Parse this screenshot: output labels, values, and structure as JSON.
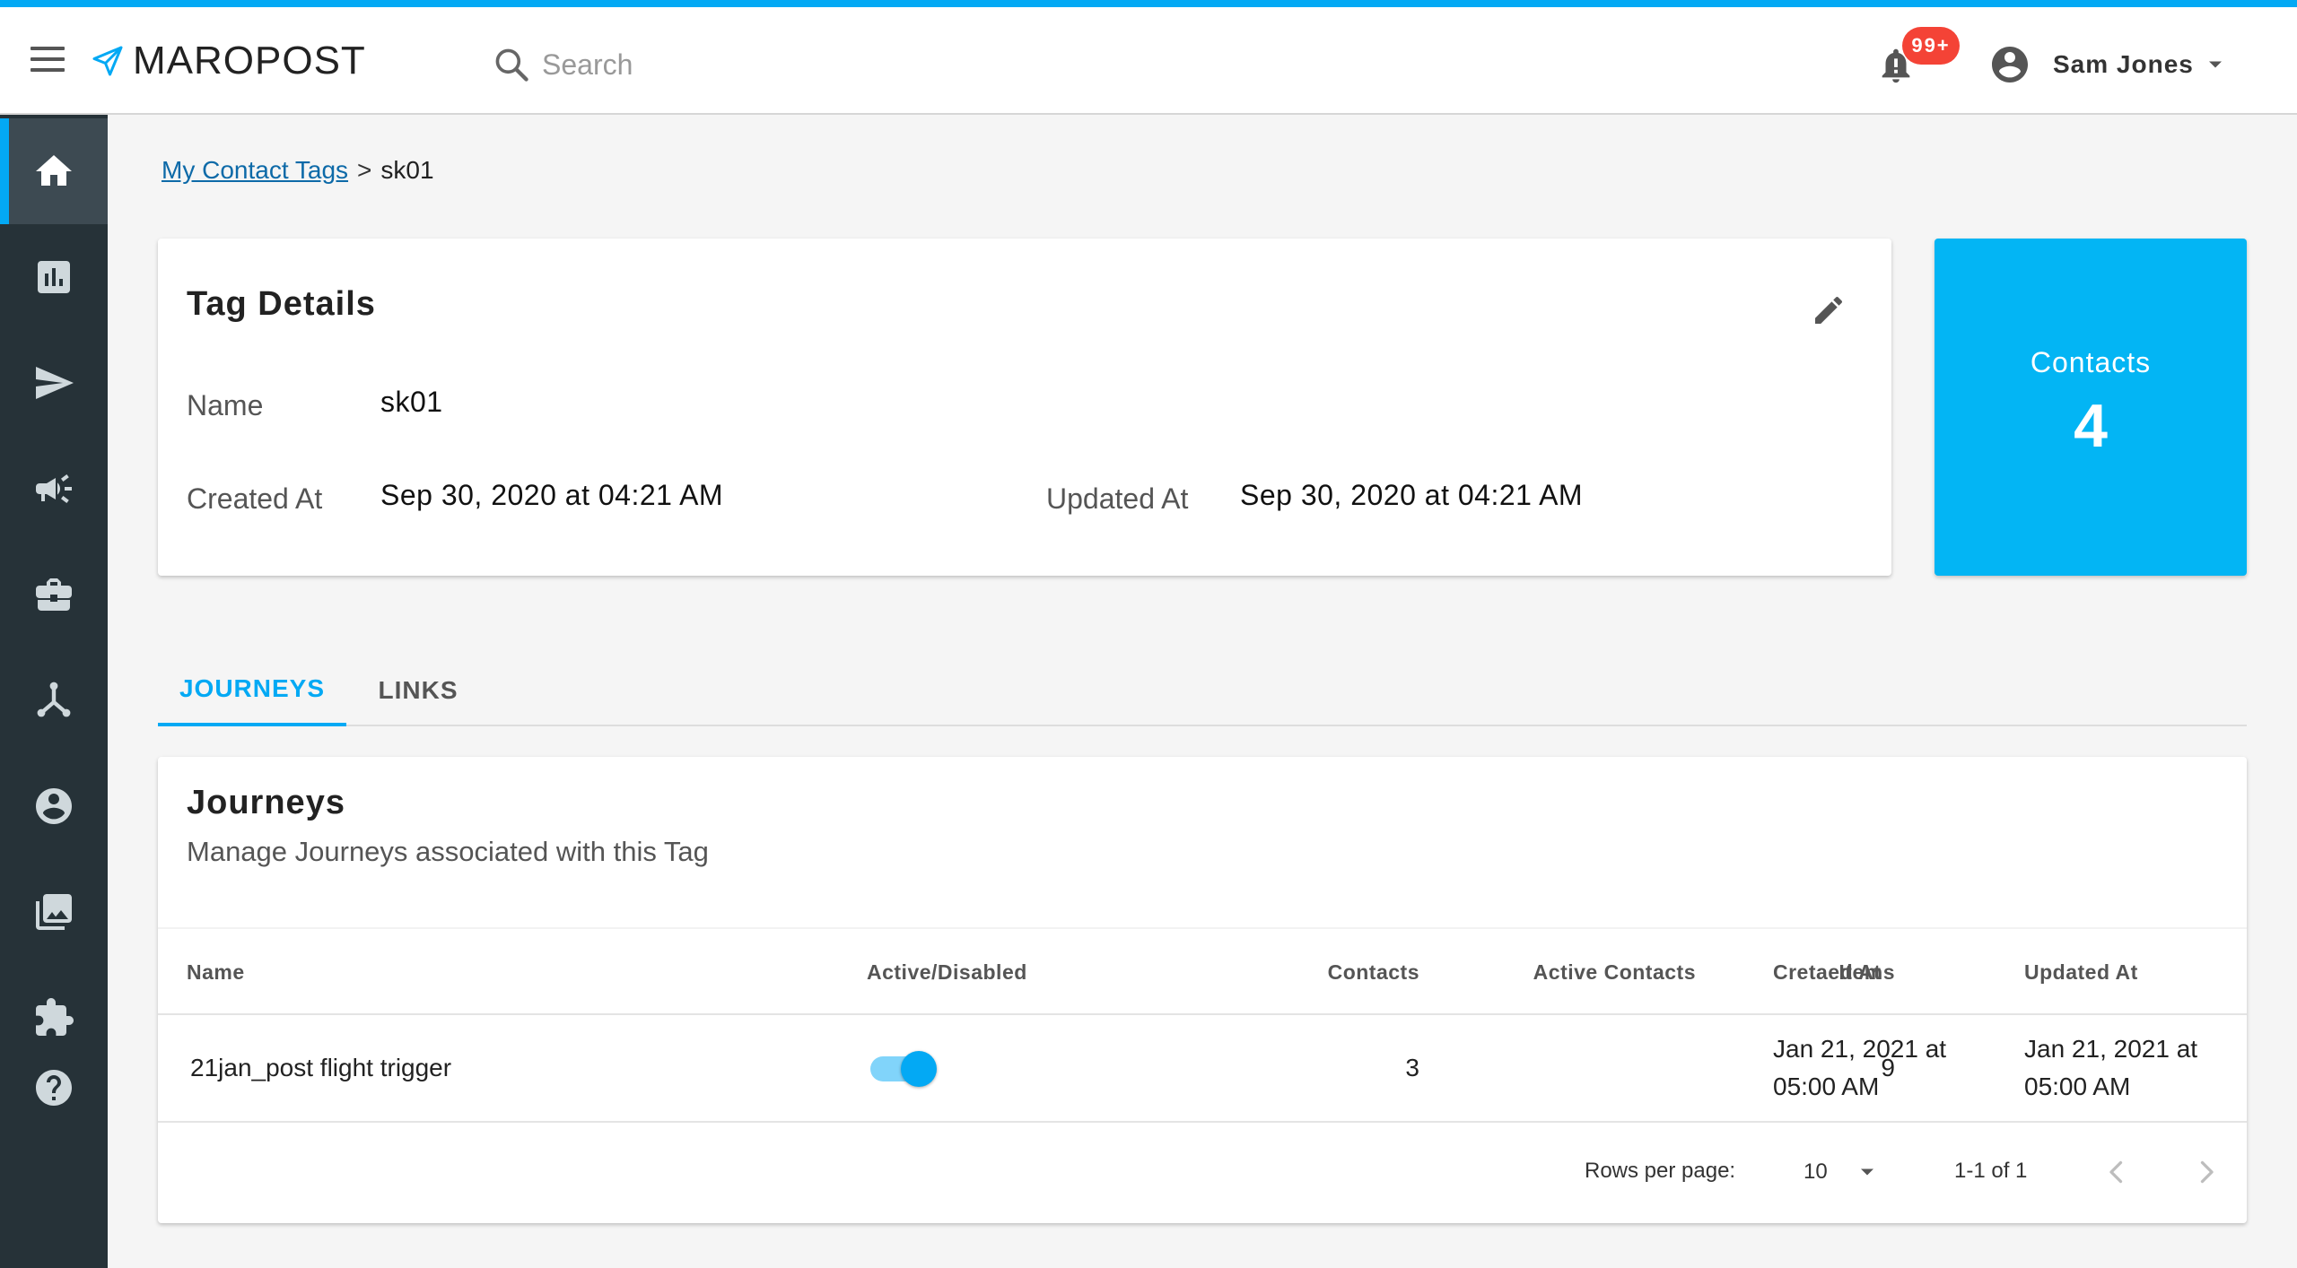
{
  "header": {
    "logo_text": "MAROPOST",
    "search_placeholder": "Search",
    "notification_badge": "99+",
    "user_name": "Sam Jones"
  },
  "sidebar": {
    "items": [
      {
        "icon": "home-icon",
        "active": true
      },
      {
        "icon": "bar-chart-icon",
        "active": false
      },
      {
        "icon": "send-icon",
        "active": false
      },
      {
        "icon": "megaphone-icon",
        "active": false
      },
      {
        "icon": "briefcase-icon",
        "active": false
      },
      {
        "icon": "journey-icon",
        "active": false
      },
      {
        "icon": "account-icon",
        "active": false
      },
      {
        "icon": "image-icon",
        "active": false
      },
      {
        "icon": "puzzle-icon",
        "active": false
      },
      {
        "icon": "help-icon",
        "active": false
      }
    ]
  },
  "breadcrumb": {
    "link": "My Contact Tags",
    "separator": ">",
    "current": "sk01"
  },
  "tag_details": {
    "title": "Tag Details",
    "name_label": "Name",
    "name_value": "sk01",
    "created_label": "Created At",
    "created_value": "Sep 30, 2020 at 04:21 AM",
    "updated_label": "Updated At",
    "updated_value": "Sep 30, 2020 at 04:21 AM"
  },
  "contacts_card": {
    "label": "Contacts",
    "count": "4"
  },
  "tabs": [
    {
      "label": "JOURNEYS",
      "active": true
    },
    {
      "label": "LINKS",
      "active": false
    }
  ],
  "journeys": {
    "title": "Journeys",
    "subtitle": "Manage Journeys associated with this Tag",
    "columns": [
      "Name",
      "Active/Disabled",
      "Contacts",
      "Active Contacts",
      "Items",
      "Cretaed At",
      "Updated At"
    ],
    "rows": [
      {
        "name": "21jan_post flight trigger",
        "active": true,
        "contacts": "3",
        "active_contacts": "",
        "items": "9",
        "created_line1": "Jan 21, 2021 at",
        "created_line2": "05:00 AM",
        "updated_line1": "Jan 21, 2021 at",
        "updated_line2": "05:00 AM"
      }
    ],
    "pagination": {
      "rows_per_page_label": "Rows per page:",
      "rows_per_page_value": "10",
      "range": "1-1 of 1"
    }
  },
  "colors": {
    "accent": "#03a9f4",
    "sidebar_bg": "#263238",
    "badge": "#f44336",
    "link": "#0d6aa8"
  }
}
